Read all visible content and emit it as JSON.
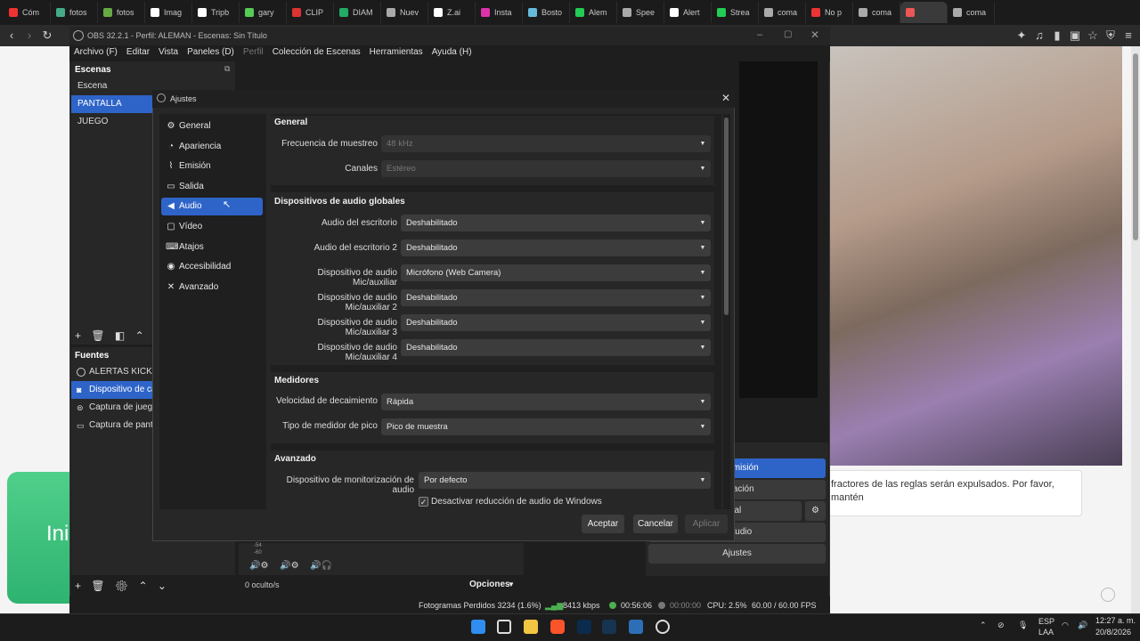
{
  "browser": {
    "tabs": [
      "Cóm",
      "fotos",
      "fotos",
      "Imag",
      "Tripb",
      "gary",
      "CLIP",
      "DIAM",
      "Nuev",
      "Z.ai",
      "Insta",
      "Bosto",
      "Alem",
      "Spee",
      "Alert",
      "Strea",
      "coma",
      "No p",
      "coma",
      "",
      "coma"
    ]
  },
  "obs": {
    "title": "OBS 32.2.1 - Perfil: ALEMAN - Escenas: Sin Título",
    "menu": [
      "Archivo (F)",
      "Editar",
      "Vista",
      "Paneles (D)",
      "Perfil",
      "Colección de Escenas",
      "Herramientas",
      "Ayuda (H)"
    ],
    "scenes": {
      "header": "Escenas",
      "items": [
        "Escena",
        "PANTALLA",
        "JUEGO"
      ]
    },
    "sources": {
      "header": "Fuentes",
      "items": [
        "ALERTAS KICK",
        "Dispositivo de cap",
        "Captura de juego",
        "Captura de pantal"
      ]
    },
    "mixer": {
      "hidden": "0 oculto/s",
      "options": "Opciones",
      "db": [
        "-54",
        "-60"
      ]
    },
    "controls": [
      "ransmisión",
      "rabación",
      "a Virtual",
      "Estudio",
      "Ajustes"
    ],
    "status": {
      "dropped": "Fotogramas Perdidos 3234 (1.6%)",
      "kbps": "8413 kbps",
      "stream_time": "00:56:06",
      "rec_time": "00:00:00",
      "cpu": "CPU: 2.5%",
      "fps": "60.00 / 60.00 FPS"
    }
  },
  "settings": {
    "title": "Ajustes",
    "nav": [
      "General",
      "Apariencia",
      "Emisión",
      "Salida",
      "Audio",
      "Vídeo",
      "Atajos",
      "Accesibilidad",
      "Avanzado"
    ],
    "general": {
      "title": "General",
      "sample_rate_label": "Frecuencia de muestreo",
      "sample_rate": "48 kHz",
      "channels_label": "Canales",
      "channels": "Estéreo"
    },
    "global_devices": {
      "title": "Dispositivos de audio globales",
      "rows": [
        {
          "label": "Audio del escritorio",
          "value": "Deshabilitado"
        },
        {
          "label": "Audio del escritorio 2",
          "value": "Deshabilitado"
        },
        {
          "label": "Dispositivo de audio Mic/auxiliar",
          "value": "Micrófono (Web Camera)"
        },
        {
          "label": "Dispositivo de audio Mic/auxiliar 2",
          "value": "Deshabilitado"
        },
        {
          "label": "Dispositivo de audio Mic/auxiliar 3",
          "value": "Deshabilitado"
        },
        {
          "label": "Dispositivo de audio Mic/auxiliar 4",
          "value": "Deshabilitado"
        }
      ]
    },
    "meters": {
      "title": "Medidores",
      "decay_label": "Velocidad de decaimiento",
      "decay": "Rápida",
      "peak_label": "Tipo de medidor de pico",
      "peak": "Pico de muestra"
    },
    "advanced": {
      "title": "Avanzado",
      "monitor_label": "Dispositivo de monitorización de audio",
      "monitor": "Por defecto",
      "ducking_label": "Desactivar reducción de audio de Windows",
      "ducking_checked": true
    },
    "buttons": {
      "accept": "Aceptar",
      "cancel": "Cancelar",
      "apply": "Aplicar"
    }
  },
  "webpage": {
    "chat_text": "fractores de las reglas serán expulsados. Por favor, mantén",
    "green_card_text": "Ini"
  },
  "taskbar": {
    "lang": "ESP",
    "lang2": "LAA",
    "time": "12:27 a. m.",
    "date": "20/8/2026"
  },
  "colors": {
    "accent": "#2e64c8",
    "bg": "#1f1f1f",
    "panel": "#272727"
  }
}
